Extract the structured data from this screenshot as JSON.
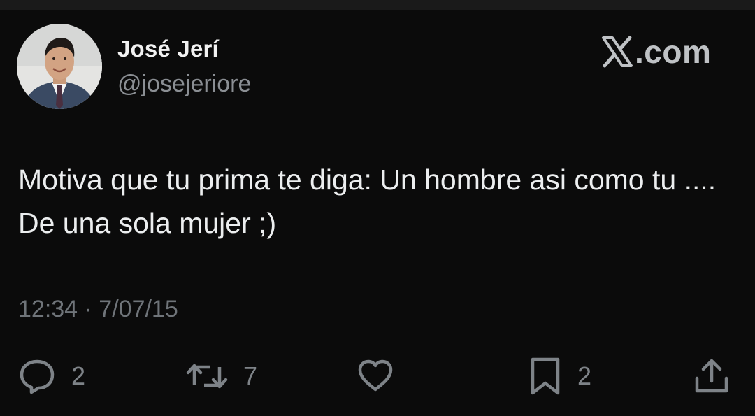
{
  "tweet": {
    "author": {
      "name": "José Jerí",
      "handle": "@josejeriore",
      "avatar": "profile-photo"
    },
    "brand": {
      "icon": "x-logo-icon",
      "text": ".com"
    },
    "text": "Motiva que tu prima te diga: Un hombre asi como tu .... De una sola mujer ;)",
    "timestamp": "12:34 · 7/07/15",
    "actions": {
      "reply": {
        "icon": "reply-icon",
        "count": "2"
      },
      "retweet": {
        "icon": "retweet-icon",
        "count": "7"
      },
      "like": {
        "icon": "heart-icon",
        "count": ""
      },
      "bookmark": {
        "icon": "bookmark-icon",
        "count": "2"
      },
      "share": {
        "icon": "share-icon"
      }
    }
  },
  "colors": {
    "background": "#0b0b0b",
    "primary_text": "#eceeef",
    "secondary_text": "#8b8f94",
    "icon": "#7e8388"
  }
}
